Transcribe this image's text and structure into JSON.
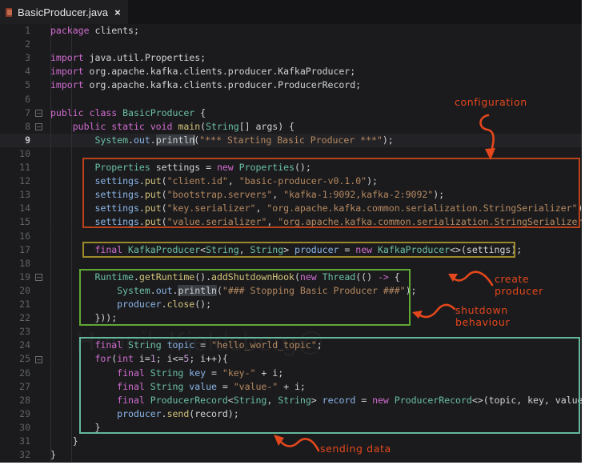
{
  "window": {
    "tab": {
      "label": "BasicProducer.java",
      "close": "×",
      "icon": "java-file-icon"
    }
  },
  "theme": {
    "background": "#1b1b1d",
    "tab_bar": "#141416",
    "current_line": "#232327",
    "line_number": "#5f6266",
    "keyword": "#cf6ccf",
    "type": "#6bbfa3",
    "string": "#b58860",
    "identifier": "#8ab4e8",
    "method": "#d2c27a",
    "number": "#c89ad6",
    "plain": "#cfd2d4",
    "annotation": "#e4471c",
    "box_configuration": "#b9421a",
    "box_create_producer": "#9c8a2a",
    "box_shutdown": "#5fa832",
    "box_sending_data": "#63b79a"
  },
  "editor": {
    "current_line_number": 9,
    "fold_markers": [
      7,
      8,
      19,
      25
    ],
    "total_lines": 32,
    "line_numbers": [
      1,
      2,
      3,
      4,
      5,
      6,
      7,
      8,
      9,
      10,
      11,
      12,
      13,
      14,
      15,
      16,
      17,
      18,
      19,
      20,
      21,
      22,
      23,
      24,
      25,
      26,
      27,
      28,
      29,
      30,
      31,
      32
    ],
    "lines": [
      "package clients;",
      "",
      "import java.util.Properties;",
      "import org.apache.kafka.clients.producer.KafkaProducer;",
      "import org.apache.kafka.clients.producer.ProducerRecord;",
      "",
      "public class BasicProducer {",
      "    public static void main(String[] args) {",
      "        System.out.println(\"*** Starting Basic Producer ***\");",
      "",
      "        Properties settings = new Properties();",
      "        settings.put(\"client.id\", \"basic-producer-v0.1.0\");",
      "        settings.put(\"bootstrap.servers\", \"kafka-1:9092,kafka-2:9092\");",
      "        settings.put(\"key.serializer\", \"org.apache.kafka.common.serialization.StringSerializer\");",
      "        settings.put(\"value.serializer\", \"org.apache.kafka.common.serialization.StringSerializer\");",
      "",
      "        final KafkaProducer<String, String> producer = new KafkaProducer<>(settings);",
      "",
      "        Runtime.getRuntime().addShutdownHook(new Thread(() -> {",
      "            System.out.println(\"### Stopping Basic Producer ###\");",
      "            producer.close();",
      "        }));",
      "",
      "        final String topic = \"hello_world_topic\";",
      "        for(int i=1; i<=5; i++){",
      "            final String key = \"key-\" + i;",
      "            final String value = \"value-\" + i;",
      "            final ProducerRecord<String, String> record = new ProducerRecord<>(topic, key, value);",
      "            producer.send(record);",
      "        }",
      "    }",
      "}"
    ]
  },
  "annotations": [
    {
      "id": "configuration",
      "text": "configuration",
      "target_lines": "11-15"
    },
    {
      "id": "create-producer",
      "text": "create\nproducer",
      "target_lines": "17"
    },
    {
      "id": "shutdown",
      "text": "shutdown\nbehaviour",
      "target_lines": "19-22"
    },
    {
      "id": "sending-data",
      "text": "sending data",
      "target_lines": "24-30"
    }
  ],
  "watermark": {
    "text": "Hennik Kjeldsberg@"
  }
}
